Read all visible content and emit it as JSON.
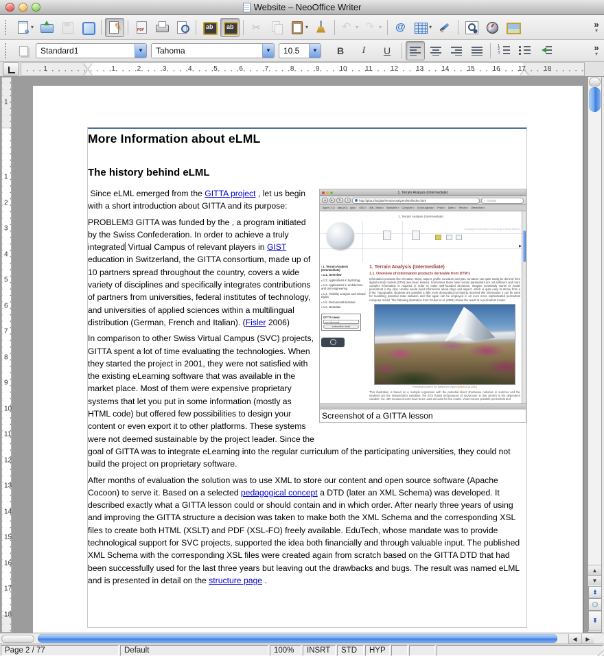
{
  "window": {
    "title": "Website – NeoOffice Writer"
  },
  "toolbar_main": {
    "overflow": "»",
    "buttons": [
      {
        "name": "new-document",
        "icon": "new",
        "dropdown": true
      },
      {
        "name": "open",
        "icon": "open"
      },
      {
        "name": "save",
        "icon": "save",
        "disabled": true
      },
      {
        "name": "document-as-email",
        "icon": "frame"
      },
      {
        "sep": true
      },
      {
        "name": "edit-file",
        "icon": "editfile",
        "pressed": true
      },
      {
        "sep": true
      },
      {
        "name": "export-as-pdf",
        "icon": "pdf"
      },
      {
        "name": "print",
        "icon": "print"
      },
      {
        "name": "page-preview",
        "icon": "preview"
      },
      {
        "sep": true
      },
      {
        "name": "spellcheck",
        "icon": "spell"
      },
      {
        "name": "auto-spellcheck",
        "icon": "spell",
        "pressed": true
      },
      {
        "sep": true
      },
      {
        "name": "cut",
        "icon": "cut",
        "disabled": true
      },
      {
        "name": "copy",
        "icon": "copy",
        "disabled": true
      },
      {
        "name": "paste",
        "icon": "paste",
        "dropdown": true
      },
      {
        "name": "format-paintbrush",
        "icon": "brush"
      },
      {
        "sep": true
      },
      {
        "name": "undo",
        "icon": "undo",
        "disabled": true,
        "dropdown": true
      },
      {
        "name": "redo",
        "icon": "redo",
        "disabled": true,
        "dropdown": true
      },
      {
        "sep": true
      },
      {
        "name": "hyperlink",
        "icon": "email"
      },
      {
        "name": "insert-table",
        "icon": "table",
        "dropdown": true
      },
      {
        "name": "show-draw-functions",
        "icon": "draw"
      },
      {
        "sep": true
      },
      {
        "name": "find-and-replace",
        "icon": "find"
      },
      {
        "name": "navigator",
        "icon": "navigator"
      },
      {
        "name": "gallery",
        "icon": "gallery"
      }
    ]
  },
  "toolbar_format": {
    "style_name": "Standard1",
    "font_name": "Tahoma",
    "font_size": "10.5",
    "overflow": "»",
    "buttons": [
      {
        "name": "bold",
        "label": "B",
        "cls": "b"
      },
      {
        "name": "italic",
        "label": "I",
        "cls": "i"
      },
      {
        "name": "underline",
        "label": "U",
        "cls": "u"
      },
      {
        "sep": true
      },
      {
        "name": "align-left",
        "icon": "al-l",
        "pressed": true
      },
      {
        "name": "align-center",
        "icon": "al-c"
      },
      {
        "name": "align-right",
        "icon": "al-r"
      },
      {
        "name": "justify",
        "icon": "al-j"
      },
      {
        "sep": true
      },
      {
        "name": "numbered-list",
        "icon": "numlist"
      },
      {
        "name": "bullet-list",
        "icon": "bullist"
      },
      {
        "name": "decrease-indent",
        "icon": "dedent"
      }
    ]
  },
  "ruler": {
    "h_pre": "1",
    "h_numbers": [
      "1",
      "2",
      "3",
      "4",
      "5",
      "6",
      "7",
      "8",
      "9",
      "10",
      "11",
      "12",
      "13",
      "14",
      "15",
      "16",
      "17",
      "18"
    ],
    "v_pre": "1",
    "v_numbers": [
      "1",
      "2",
      "3",
      "4",
      "5",
      "6",
      "7",
      "8",
      "9",
      "10",
      "11",
      "12",
      "13",
      "14",
      "15",
      "16",
      "17",
      "18"
    ]
  },
  "document": {
    "heading1": "More Information about eLML",
    "heading2": "The history behind eLML",
    "p1": [
      {
        "t": " Since eLML emerged from the "
      },
      {
        "t": "GITTA project",
        "link": true
      },
      {
        "t": " , let us begin with a short introduction about GITTA and its purpose:"
      }
    ],
    "p2": [
      {
        "t": "PROBLEM3 GITTA was funded by the , a program initiated by the Swiss Confederation. In order to achieve a truly integrated"
      },
      {
        "caret": true
      },
      {
        "t": " Virtual Campus of relevant players in "
      },
      {
        "t": "GIST",
        "link": true
      },
      {
        "t": " education in Switzerland, the GITTA consortium, made up of 10 partners spread throughout the country, covers a wide variety of disciplines and specifically integrates contributions of partners from universities, federal institutes of technology, and universities of applied sciences within a multilingual distribution (German, French and Italian). ("
      },
      {
        "t": "Fisler",
        "link": true
      },
      {
        "t": " 2006)"
      }
    ],
    "p3": [
      {
        "t": "In comparison to other Swiss Virtual Campus (SVC) projects, GITTA spent a lot of time evaluating the technologies. When they started the project in 2001, they were not satisfied with the existing eLearning software that was available in the market place. Most of them were expensive proprietary systems that let you put in some information (mostly as HTML code) but offered few possibilities to design your content or even export it to other platforms. These systems were not deemed sustainable by the project leader. Since the goal of GITTA was to integrate eLearning into the regular curriculum of the participating universities, they could not build the project on proprietary software."
      }
    ],
    "p4": [
      {
        "t": "After months of evaluation the solution was to use XML to store our content and open source software (Apache Cocoon) to serve it. Based on a selected "
      },
      {
        "t": "pedagogical concept",
        "link": true
      },
      {
        "t": " a DTD (later an XML Schema) was developed. It described exactly what a GITTA lesson could or should contain and in which order. After nearly three years of using and improving the GITTA structure a decision was taken to make both the XML Schema and the corresponding XSL files to create both HTML (XSLT) and PDF (XSL-FO) freely available. EduTech, whose mandate was to provide technological support for SVC projects, supported the idea both financially and through valuable input. The published XML Schema with the corresponding XSL files were created again from scratch based on the GITTA DTD that had been successfully used for the last three years but leaving out the drawbacks and bugs. The result was named eLML and is presented in detail on the "
      },
      {
        "t": "structure page",
        "link": true
      },
      {
        "t": " ."
      }
    ]
  },
  "figure": {
    "caption": "Screenshot of a GITTA lesson",
    "browser": {
      "title": "1. Terrain Analysis (Intermediate)",
      "back": "◂",
      "forward": "▸",
      "reload": "↻",
      "add": "+",
      "url": "http://gitta.info/gitta/TerrainAnaly/en/html/index.html",
      "search": "Google",
      "bookmarks": [
        "Apple (1:1)",
        "daily (91)",
        "jako",
        "GIS2",
        "XML_Stand",
        "SysAdmin",
        "Computer",
        "Grüne Agenda",
        "Privat",
        "Daten",
        "Reisen",
        "Übersetzen"
      ],
      "breadcrumb": "1. Terrain Analysis (Intermediate)",
      "banner_text": "Geographic Information Technology Training Alliance",
      "heading": "1. Terrain Analysis (Intermediate)",
      "subheading": "1.1. Overview of information products derivable from DTM's",
      "body1": "Information products like elevation, slope, aspect, profile curvature and plan curvature can quite easily be derived from digital terrain models (DTM) (see basic lesson). Sometimes these basic terrain parameters are not sufficient and more complex information is required in order to make well-founded decisions. Imagine somebody wants to model permafrost in the Alps. He/she would need information about slope and aspect, which is quite easy to derive from a DTM. Topographic shadows are possibly a little more demanding but having received this information it can be used for modelling potential solar radiation and that again can be employed in an even more sophisticated permafrost computer model. The following illustration from Gruber et al. (2001) shows the result of a permafrost model:",
      "photo_caption_pre": "Permafrost model in the Matterhorn region (",
      "photo_caption_cite": "Gruber et al. 2001",
      "photo_caption_post": ")",
      "body2": "This illustration is based on a multiple regression with the potential direct shortwave radiation in summer and the sealevel are the independent variables, the BTS (basis temperature of snowcover in late winter) is the dependent variable. Ca. 400 measurements have been used as basis for the model. Violet means possible permafrost and",
      "nav": [
        "1. Terrain Analysis (Intermediate)",
        "1.1. Overview",
        "1.2. Applications in hydrology",
        "1.3. Applications in architecture and civil engineering",
        "1.4. Visibility analysis and related topics",
        "1.5. Resources/Literature",
        "1.6. Metadata"
      ],
      "news_label": "GITTA news:",
      "news_input": "your@email",
      "news_button": "subscribe now!"
    }
  },
  "statusbar": {
    "page": "Page 2 / 77",
    "page_style": "Default",
    "zoom": "100%",
    "insert_mode": "INSRT",
    "selection_mode": "STD",
    "hyperlink_mode": "HYP"
  }
}
